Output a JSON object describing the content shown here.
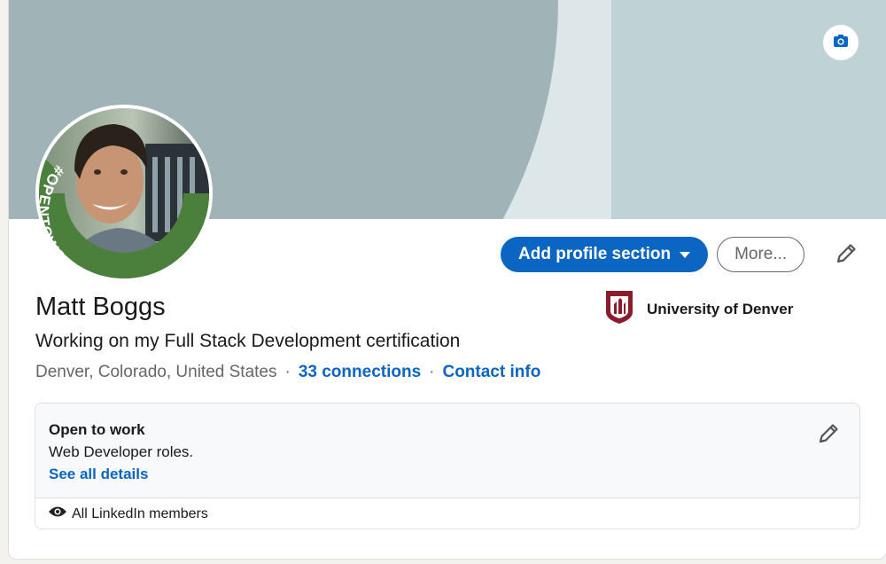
{
  "profile": {
    "name": "Matt Boggs",
    "headline": "Working on my Full Stack Development certification",
    "location": "Denver, Colorado, United States",
    "connections": "33 connections",
    "contact": "Contact info",
    "separator": "·",
    "open_to_work_frame": "#OPENTOWORK"
  },
  "actions": {
    "add_section": "Add profile section",
    "more": "More..."
  },
  "education": {
    "name": "University of Denver"
  },
  "open_to_work": {
    "title": "Open to work",
    "description": "Web Developer roles.",
    "details_link": "See all details",
    "visibility": "All LinkedIn members"
  },
  "icons": {
    "camera": "camera-icon",
    "edit": "pencil-icon",
    "caret": "caret-down-icon",
    "eye": "eye-icon",
    "school_logo": "university-logo"
  },
  "colors": {
    "accent": "#0a66c2",
    "open_to_work_green": "#4b7f3c",
    "school_red": "#8b1c2b"
  }
}
